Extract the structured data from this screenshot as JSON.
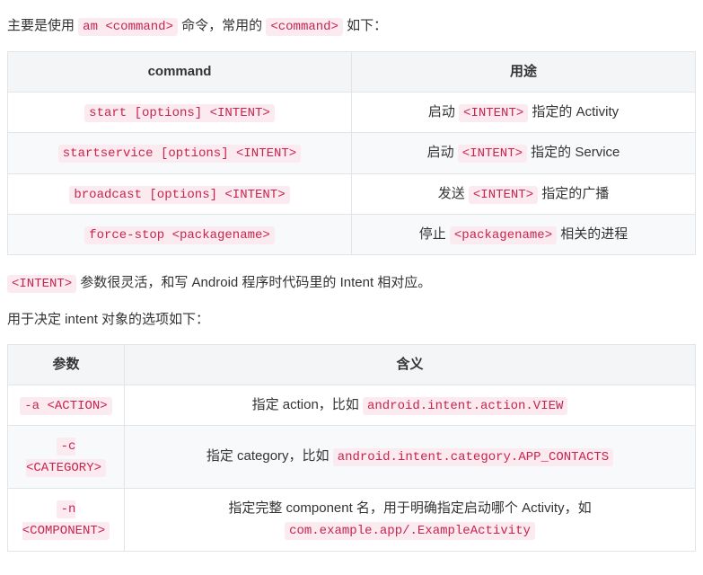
{
  "intro": {
    "pre1": "主要是使用 ",
    "code1": "am <command>",
    "mid1": " 命令，常用的 ",
    "code2": "<command>",
    "post1": " 如下："
  },
  "table1": {
    "headers": [
      "command",
      "用途"
    ],
    "rows": [
      {
        "cmd": "start [options] <INTENT>",
        "use_pre": "启动 ",
        "use_code": "<INTENT>",
        "use_post": " 指定的 Activity"
      },
      {
        "cmd": "startservice [options] <INTENT>",
        "use_pre": "启动 ",
        "use_code": "<INTENT>",
        "use_post": " 指定的 Service"
      },
      {
        "cmd": "broadcast [options] <INTENT>",
        "use_pre": "发送 ",
        "use_code": "<INTENT>",
        "use_post": " 指定的广播"
      },
      {
        "cmd": "force-stop <packagename>",
        "use_pre": "停止 ",
        "use_code": "<packagename>",
        "use_post": " 相关的进程"
      }
    ]
  },
  "mid1": {
    "code1": "<INTENT>",
    "text1": " 参数很灵活，和写 Android 程序时代码里的 Intent 相对应。"
  },
  "mid2": {
    "text": "用于决定 intent 对象的选项如下："
  },
  "table2": {
    "headers": [
      "参数",
      "含义"
    ],
    "rows": [
      {
        "param": "-a <ACTION>",
        "meaning_pre": "指定 action，比如 ",
        "meaning_code": "android.intent.action.VIEW",
        "meaning_post": ""
      },
      {
        "param": "-c <CATEGORY>",
        "meaning_pre": "指定 category，比如 ",
        "meaning_code": "android.intent.category.APP_CONTACTS",
        "meaning_post": ""
      },
      {
        "param": "-n <COMPONENT>",
        "meaning_pre": "指定完整 component 名，用于明确指定启动哪个 Activity，如 ",
        "meaning_code": "com.example.app/.ExampleActivity",
        "meaning_post": ""
      }
    ]
  }
}
